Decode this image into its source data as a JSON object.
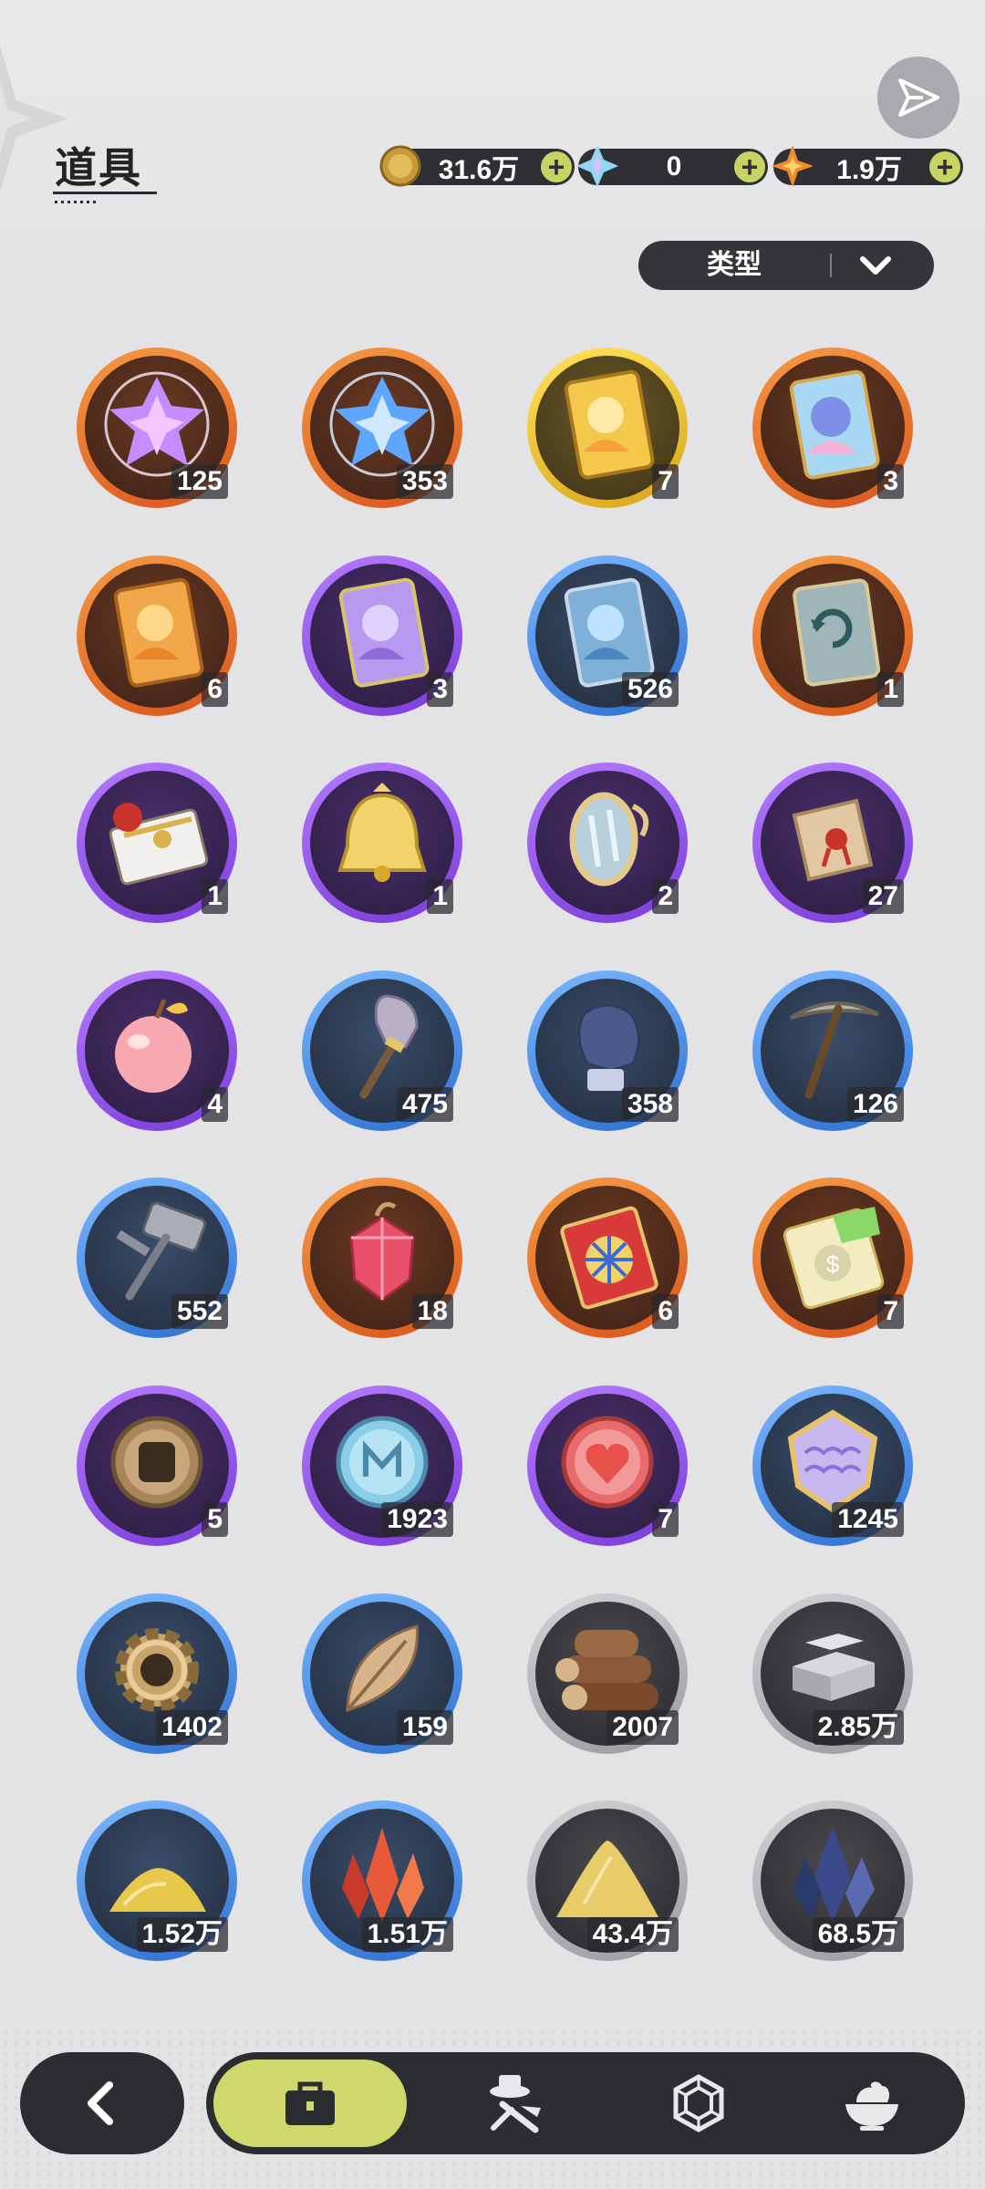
{
  "header": {
    "title": "道具",
    "share_icon": "share-arrow-icon"
  },
  "currencies": [
    {
      "name": "gold-coin",
      "amount": "31.6万",
      "icon": "gold-coin-icon"
    },
    {
      "name": "crystal",
      "amount": "0",
      "icon": "crystal-icon"
    },
    {
      "name": "star-gem",
      "amount": "1.9万",
      "icon": "star-gem-icon"
    }
  ],
  "filter": {
    "label": "类型",
    "icon": "chevron-down-icon"
  },
  "items": [
    {
      "icon": "purple-crystal-cluster-icon",
      "rarity": "orange",
      "count": "125"
    },
    {
      "icon": "blue-crystal-cluster-icon",
      "rarity": "orange",
      "count": "353"
    },
    {
      "icon": "gold-character-card-icon",
      "rarity": "gold",
      "count": "7"
    },
    {
      "icon": "rainbow-character-card-icon",
      "rarity": "orange",
      "count": "3"
    },
    {
      "icon": "orange-character-card-icon",
      "rarity": "orange",
      "count": "6"
    },
    {
      "icon": "purple-character-card-icon",
      "rarity": "purple",
      "count": "3"
    },
    {
      "icon": "blue-character-card-icon",
      "rarity": "blue",
      "count": "526"
    },
    {
      "icon": "reset-card-icon",
      "rarity": "orange",
      "count": "1"
    },
    {
      "icon": "gift-box-icon",
      "rarity": "purple",
      "count": "1"
    },
    {
      "icon": "golden-bell-icon",
      "rarity": "purple",
      "count": "1"
    },
    {
      "icon": "magic-mirror-icon",
      "rarity": "purple",
      "count": "2"
    },
    {
      "icon": "scroll-icon",
      "rarity": "purple",
      "count": "27"
    },
    {
      "icon": "pink-apple-icon",
      "rarity": "purple",
      "count": "4"
    },
    {
      "icon": "shovel-icon",
      "rarity": "blue",
      "count": "475"
    },
    {
      "icon": "boxing-glove-icon",
      "rarity": "blue",
      "count": "358"
    },
    {
      "icon": "pickaxe-icon",
      "rarity": "blue",
      "count": "126"
    },
    {
      "icon": "hammer-icon",
      "rarity": "blue",
      "count": "552"
    },
    {
      "icon": "ruby-fruit-icon",
      "rarity": "orange",
      "count": "18"
    },
    {
      "icon": "roulette-ticket-icon",
      "rarity": "orange",
      "count": "6"
    },
    {
      "icon": "rainbow-ticket-icon",
      "rarity": "orange",
      "count": "7"
    },
    {
      "icon": "fist-coin-icon",
      "rarity": "purple",
      "count": "5"
    },
    {
      "icon": "blue-rune-coin-icon",
      "rarity": "purple",
      "count": "1923"
    },
    {
      "icon": "heart-coin-icon",
      "rarity": "purple",
      "count": "7"
    },
    {
      "icon": "scale-shield-icon",
      "rarity": "blue",
      "count": "1245"
    },
    {
      "icon": "gear-icon",
      "rarity": "blue",
      "count": "1402"
    },
    {
      "icon": "leaf-icon",
      "rarity": "blue",
      "count": "159"
    },
    {
      "icon": "wood-logs-icon",
      "rarity": "gray",
      "count": "2007"
    },
    {
      "icon": "stone-blocks-icon",
      "rarity": "gray",
      "count": "2.85万"
    },
    {
      "icon": "gold-dust-icon",
      "rarity": "blue",
      "count": "1.52万"
    },
    {
      "icon": "red-crystal-icon",
      "rarity": "blue",
      "count": "1.51万"
    },
    {
      "icon": "sand-pile-icon",
      "rarity": "gray",
      "count": "43.4万"
    },
    {
      "icon": "dark-crystal-icon",
      "rarity": "gray",
      "count": "68.5万"
    }
  ],
  "nav": {
    "back_icon": "back-arrow-icon",
    "tabs": [
      {
        "icon": "briefcase-icon",
        "active": true
      },
      {
        "icon": "hat-and-tools-icon",
        "active": false
      },
      {
        "icon": "hexagon-gem-icon",
        "active": false
      },
      {
        "icon": "bowl-icon",
        "active": false
      }
    ]
  }
}
